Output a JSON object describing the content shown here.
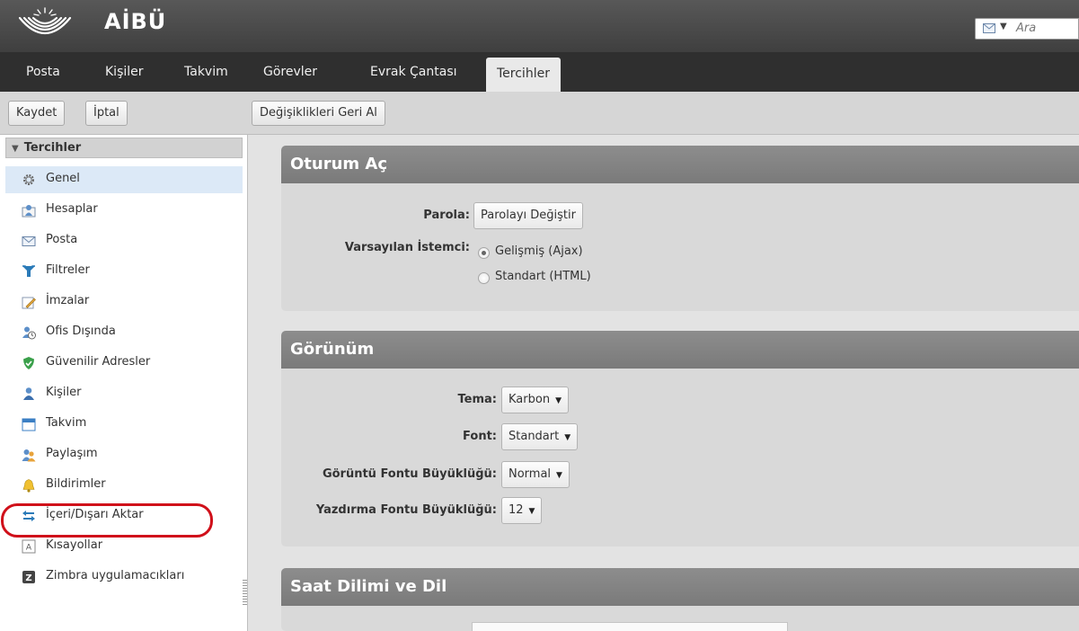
{
  "header": {
    "brand": "AİBÜ",
    "search_placeholder": "Ara",
    "search_icon": "mail-icon"
  },
  "tabs": [
    {
      "label": "Posta"
    },
    {
      "label": "Kişiler"
    },
    {
      "label": "Takvim"
    },
    {
      "label": "Görevler"
    },
    {
      "label": "Evrak Çantası"
    },
    {
      "label": "Tercihler",
      "active": true
    }
  ],
  "toolbar": {
    "save_label": "Kaydet",
    "cancel_label": "İptal",
    "revert_label": "Değişiklikleri Geri Al"
  },
  "sidebar": {
    "title": "Tercihler",
    "items": [
      {
        "label": "Genel",
        "icon": "gear-icon",
        "selected": true
      },
      {
        "label": "Hesaplar",
        "icon": "accounts-icon"
      },
      {
        "label": "Posta",
        "icon": "envelope-icon"
      },
      {
        "label": "Filtreler",
        "icon": "filter-icon"
      },
      {
        "label": "İmzalar",
        "icon": "signature-icon"
      },
      {
        "label": "Ofis Dışında",
        "icon": "out-of-office-icon"
      },
      {
        "label": "Güvenilir Adresler",
        "icon": "shield-icon"
      },
      {
        "label": "Kişiler",
        "icon": "person-icon"
      },
      {
        "label": "Takvim",
        "icon": "calendar-icon"
      },
      {
        "label": "Paylaşım",
        "icon": "sharing-icon"
      },
      {
        "label": "Bildirimler",
        "icon": "bell-icon"
      },
      {
        "label": "İçeri/Dışarı Aktar",
        "icon": "import-export-icon",
        "highlighted": true
      },
      {
        "label": "Kısayollar",
        "icon": "shortcut-icon"
      },
      {
        "label": "Zimbra uygulamacıkları",
        "icon": "zimlet-icon"
      }
    ]
  },
  "sections": {
    "login": {
      "title": "Oturum Aç",
      "password_label": "Parola:",
      "password_button": "Parolayı Değiştir",
      "client_label": "Varsayılan İstemci:",
      "client_options": [
        "Gelişmiş (Ajax)",
        "Standart (HTML)"
      ],
      "client_selected": "Gelişmiş (Ajax)"
    },
    "appearance": {
      "title": "Görünüm",
      "theme_label": "Tema:",
      "theme_value": "Karbon",
      "font_label": "Font:",
      "font_value": "Standart",
      "display_size_label": "Görüntü Fontu Büyüklüğü:",
      "display_size_value": "Normal",
      "print_size_label": "Yazdırma Fontu Büyüklüğü:",
      "print_size_value": "12"
    },
    "timezone": {
      "title": "Saat Dilimi ve Dil"
    }
  },
  "colors": {
    "header_bg": "#4a4a4a",
    "tabbar_bg": "#2f2f2f",
    "section_title_bg": "#858585",
    "selected_item_bg": "#dce9f7",
    "highlight_oval": "#d0101a"
  }
}
